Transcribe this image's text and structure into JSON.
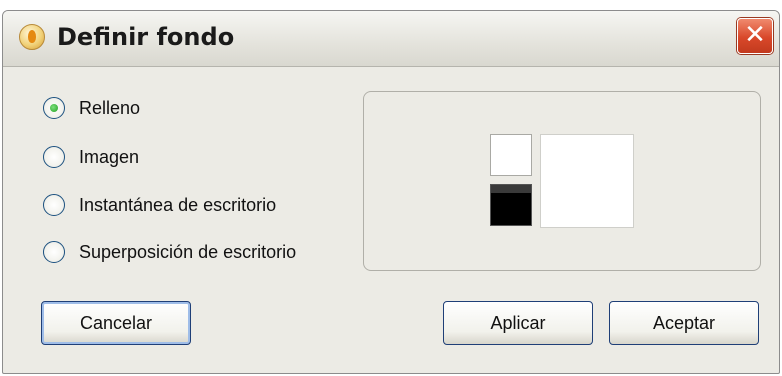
{
  "window": {
    "title": "Definir fondo",
    "close_glyph": "✕",
    "icon": "app-flame-icon"
  },
  "options": [
    {
      "label": "Relleno",
      "checked": true
    },
    {
      "label": "Imagen",
      "checked": false
    },
    {
      "label": "Instantánea de escritorio",
      "checked": false
    },
    {
      "label": "Superposición de escritorio",
      "checked": false
    }
  ],
  "preview": {
    "foreground_color": "#ffffff",
    "background_color": "#000000",
    "preview_color": "#ffffff"
  },
  "buttons": {
    "cancel": "Cancelar",
    "apply": "Aplicar",
    "accept": "Aceptar"
  }
}
